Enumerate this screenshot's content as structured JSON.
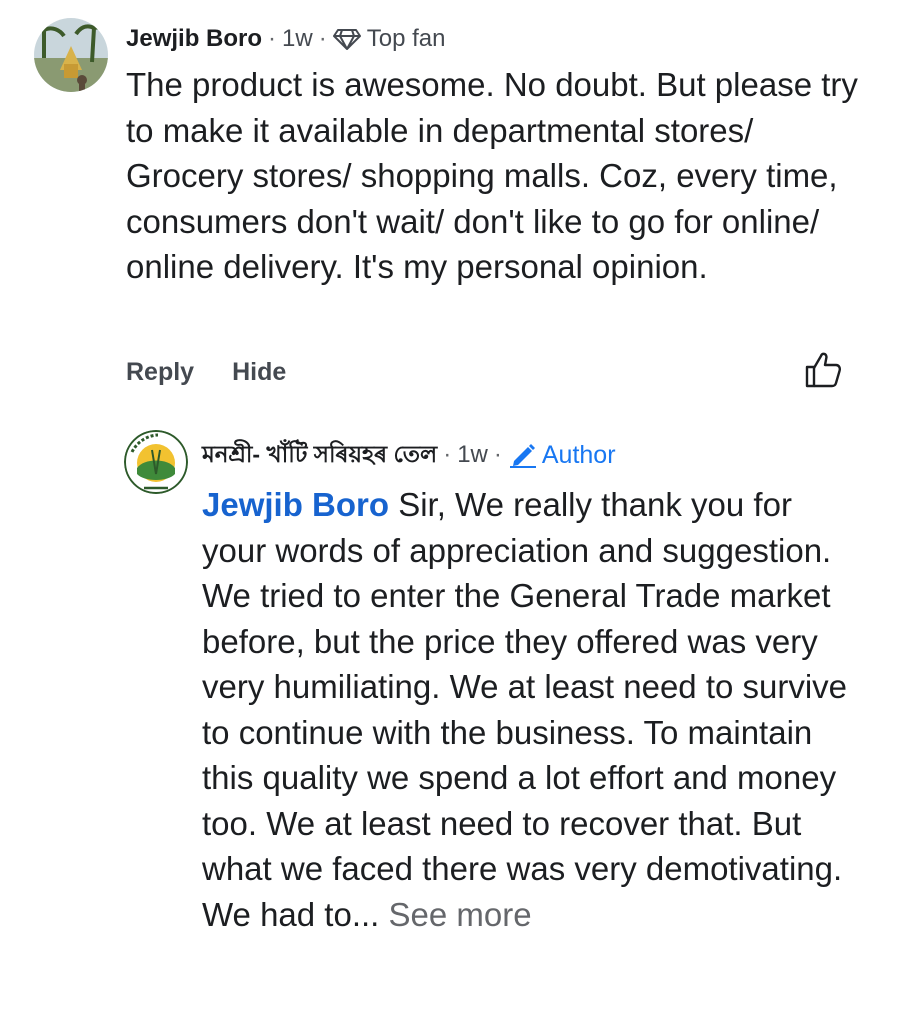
{
  "comment": {
    "author": "Jewjib Boro",
    "time": "1w",
    "badge_icon": "diamond-icon",
    "badge_label": "Top fan",
    "text": "The product is awesome. No doubt. But please try to make it available in departmental stores/ Grocery stores/ shopping malls. Coz, every time, consumers don't wait/ don't like to go for online/ online delivery. It's my personal opinion.",
    "actions": {
      "reply": "Reply",
      "hide": "Hide"
    },
    "like_icon": "thumbs-up-icon"
  },
  "reply": {
    "author": "মনশ্ৰী- খাঁটি সৰিয়হৰ তেল",
    "time": "1w",
    "badge_icon": "pencil-icon",
    "badge_label": "Author",
    "mention": "Jewjib Boro",
    "text": " Sir, We really thank you for your words of appreciation and suggestion. We tried to enter the General Trade market before, but the price they offered was very very humiliating. We at least need to survive to continue with the business. To maintain this quality we spend a lot effort and money too. We at least need to recover that. But what we faced there was very demotivating. We had to...",
    "see_more": " See more"
  },
  "colors": {
    "text": "#1c1e21",
    "secondary": "#444950",
    "author_blue": "#1877f2",
    "mention_blue": "#1763cf"
  }
}
